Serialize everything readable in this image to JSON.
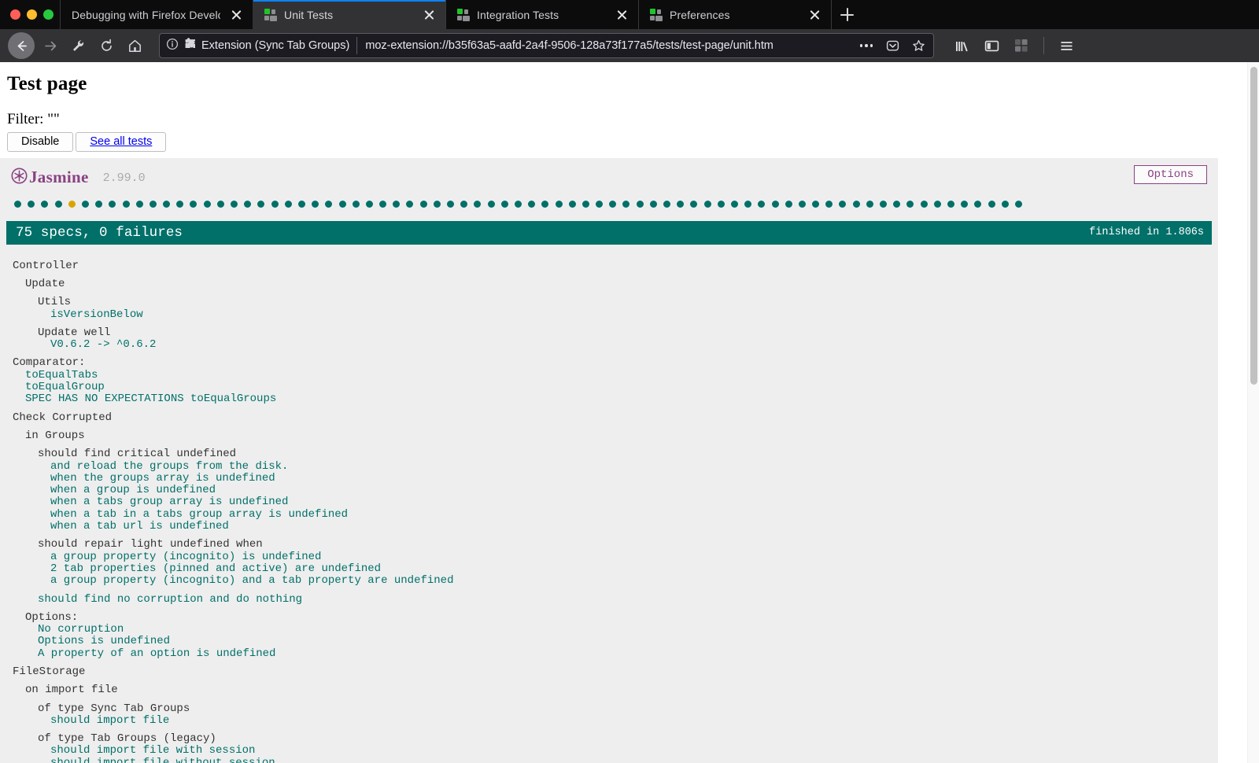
{
  "window": {
    "traffic_lights": [
      "close",
      "minimize",
      "maximize"
    ]
  },
  "tabs": [
    {
      "title": "Debugging with Firefox Developer T",
      "active": false,
      "favicon": "none",
      "close_label": "×"
    },
    {
      "title": "Unit Tests",
      "active": true,
      "favicon": "sync-tab-groups-icon",
      "close_label": "×"
    },
    {
      "title": "Integration Tests",
      "active": false,
      "favicon": "sync-tab-groups-icon",
      "close_label": "×"
    },
    {
      "title": "Preferences",
      "active": false,
      "favicon": "sync-tab-groups-icon",
      "close_label": "×"
    }
  ],
  "newtab": {
    "label": "+"
  },
  "toolbar": {
    "back_icon": "back-arrow-icon",
    "forward_icon": "forward-arrow-icon",
    "tools_icon": "wrench-icon",
    "reload_icon": "reload-icon",
    "home_icon": "home-icon",
    "library_icon": "library-icon",
    "sidebar_icon": "sidebar-icon",
    "extension_icon": "sync-tab-groups-icon",
    "menu_icon": "hamburger-menu-icon"
  },
  "urlbar": {
    "identity_icon": "info-circle-icon",
    "extension_icon": "puzzle-piece-icon",
    "identity_label": "Extension (Sync Tab Groups)",
    "url": "moz-extension://b35f63a5-aafd-2a4f-9506-128a73f177a5/tests/test-page/unit.htm",
    "page_actions_icon": "ellipsis-icon",
    "pocket_icon": "pocket-icon",
    "bookmark_icon": "star-icon"
  },
  "page": {
    "title": "Test page",
    "filter_line": "Filter: \"\"",
    "disable_button": "Disable",
    "see_all_tests_link": "See all tests"
  },
  "jasmine": {
    "brand": "Jasmine",
    "version": "2.99.0",
    "options_button": "Options",
    "summary": "75 specs, 0 failures",
    "duration": "finished in 1.806s",
    "pass_color": "#007069",
    "pending_color": "#d9a400",
    "brand_color": "#8a4182",
    "dots": [
      "passed",
      "passed",
      "passed",
      "passed",
      "pending",
      "passed",
      "passed",
      "passed",
      "passed",
      "passed",
      "passed",
      "passed",
      "passed",
      "passed",
      "passed",
      "passed",
      "passed",
      "passed",
      "passed",
      "passed",
      "passed",
      "passed",
      "passed",
      "passed",
      "passed",
      "passed",
      "passed",
      "passed",
      "passed",
      "passed",
      "passed",
      "passed",
      "passed",
      "passed",
      "passed",
      "passed",
      "passed",
      "passed",
      "passed",
      "passed",
      "passed",
      "passed",
      "passed",
      "passed",
      "passed",
      "passed",
      "passed",
      "passed",
      "passed",
      "passed",
      "passed",
      "passed",
      "passed",
      "passed",
      "passed",
      "passed",
      "passed",
      "passed",
      "passed",
      "passed",
      "passed",
      "passed",
      "passed",
      "passed",
      "passed",
      "passed",
      "passed",
      "passed",
      "passed",
      "passed",
      "passed",
      "passed",
      "passed",
      "passed",
      "passed"
    ],
    "results": [
      {
        "type": "suite",
        "name": "Controller",
        "children": [
          {
            "type": "suite",
            "name": "Update",
            "children": [
              {
                "type": "suite",
                "name": "Utils",
                "children": [
                  {
                    "type": "spec",
                    "name": "isVersionBelow",
                    "status": "passed"
                  }
                ]
              },
              {
                "type": "suite",
                "name": "Update well",
                "children": [
                  {
                    "type": "spec",
                    "name": "V0.6.2 -> ^0.6.2",
                    "status": "passed"
                  }
                ]
              }
            ]
          }
        ]
      },
      {
        "type": "suite",
        "name": "Comparator:",
        "children": [
          {
            "type": "spec",
            "name": "toEqualTabs",
            "status": "passed"
          },
          {
            "type": "spec",
            "name": "toEqualGroup",
            "status": "passed"
          },
          {
            "type": "spec",
            "name": "SPEC HAS NO EXPECTATIONS toEqualGroups",
            "status": "passed"
          }
        ]
      },
      {
        "type": "suite",
        "name": "Check Corrupted",
        "children": [
          {
            "type": "suite",
            "name": "in Groups",
            "children": [
              {
                "type": "suite",
                "name": "should find critical undefined",
                "children": [
                  {
                    "type": "spec",
                    "name": "and reload the groups from the disk.",
                    "status": "passed"
                  },
                  {
                    "type": "spec",
                    "name": "when the groups array is undefined",
                    "status": "passed"
                  },
                  {
                    "type": "spec",
                    "name": "when a group is undefined",
                    "status": "passed"
                  },
                  {
                    "type": "spec",
                    "name": "when a tabs group array is undefined",
                    "status": "passed"
                  },
                  {
                    "type": "spec",
                    "name": "when a tab in a tabs group array is undefined",
                    "status": "passed"
                  },
                  {
                    "type": "spec",
                    "name": "when a tab url is undefined",
                    "status": "passed"
                  }
                ]
              },
              {
                "type": "suite",
                "name": "should repair light undefined when",
                "children": [
                  {
                    "type": "spec",
                    "name": "a group property (incognito) is undefined",
                    "status": "passed"
                  },
                  {
                    "type": "spec",
                    "name": "2 tab properties (pinned and active) are undefined",
                    "status": "passed"
                  },
                  {
                    "type": "spec",
                    "name": "a group property (incognito) and a tab property are undefined",
                    "status": "passed"
                  }
                ]
              },
              {
                "type": "spec",
                "name": "should find no corruption and do nothing",
                "status": "passed",
                "spaced": true
              }
            ]
          },
          {
            "type": "suite",
            "name": "Options:",
            "children": [
              {
                "type": "spec",
                "name": "No corruption",
                "status": "passed"
              },
              {
                "type": "spec",
                "name": "Options is undefined",
                "status": "passed"
              },
              {
                "type": "spec",
                "name": "A property of an option is undefined",
                "status": "passed"
              }
            ]
          }
        ]
      },
      {
        "type": "suite",
        "name": "FileStorage",
        "children": [
          {
            "type": "suite",
            "name": "on import file",
            "children": [
              {
                "type": "suite",
                "name": "of type Sync Tab Groups",
                "children": [
                  {
                    "type": "spec",
                    "name": "should import file",
                    "status": "passed"
                  }
                ]
              },
              {
                "type": "suite",
                "name": "of type Tab Groups (legacy)",
                "children": [
                  {
                    "type": "spec",
                    "name": "should import file with session",
                    "status": "passed"
                  },
                  {
                    "type": "spec",
                    "name": "should import file without session",
                    "status": "passed"
                  }
                ]
              }
            ]
          }
        ]
      }
    ]
  }
}
